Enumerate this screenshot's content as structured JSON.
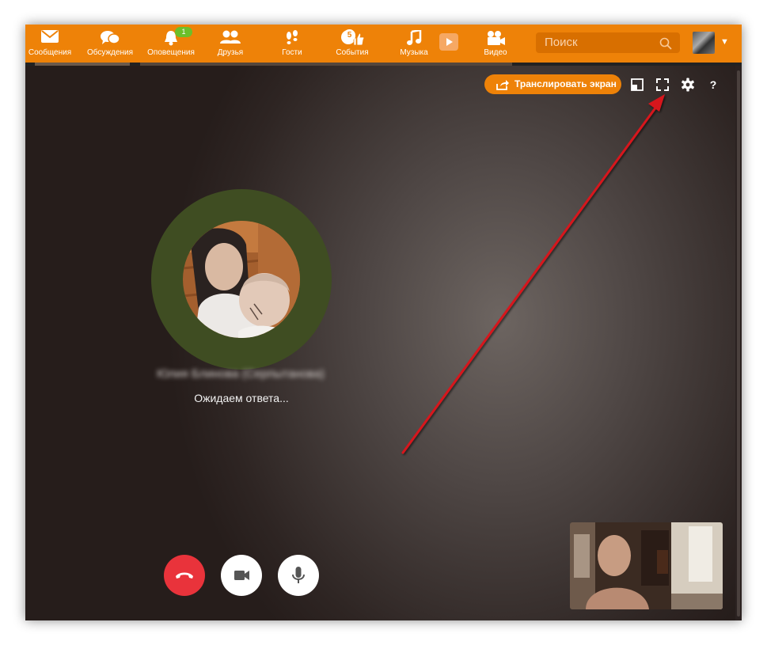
{
  "nav": {
    "items": [
      {
        "label": "Сообщения",
        "icon": "envelope-icon"
      },
      {
        "label": "Обсуждения",
        "icon": "chat-bubbles-icon"
      },
      {
        "label": "Оповещения",
        "icon": "bell-icon",
        "badge": "1"
      },
      {
        "label": "Друзья",
        "icon": "friends-icon"
      },
      {
        "label": "Гости",
        "icon": "footprints-icon"
      },
      {
        "label": "События",
        "icon": "thumbs-up-icon",
        "badge": "5"
      },
      {
        "label": "Музыка",
        "icon": "music-note-icon"
      },
      {
        "label": "Видео",
        "icon": "video-camera-icon"
      }
    ]
  },
  "search": {
    "placeholder": "Поиск"
  },
  "call": {
    "stream_button": "Транслировать экран",
    "caller_name": "Юлия Блинова (Серпытанова)",
    "status": "Ожидаем ответа...",
    "help": "?"
  },
  "colors": {
    "brand_orange": "#ee8208",
    "badge_green": "#6cbf2a",
    "hangup_red": "#e9333b",
    "ring_green": "#3f4d22",
    "annotation_arrow": "#d7161e"
  }
}
